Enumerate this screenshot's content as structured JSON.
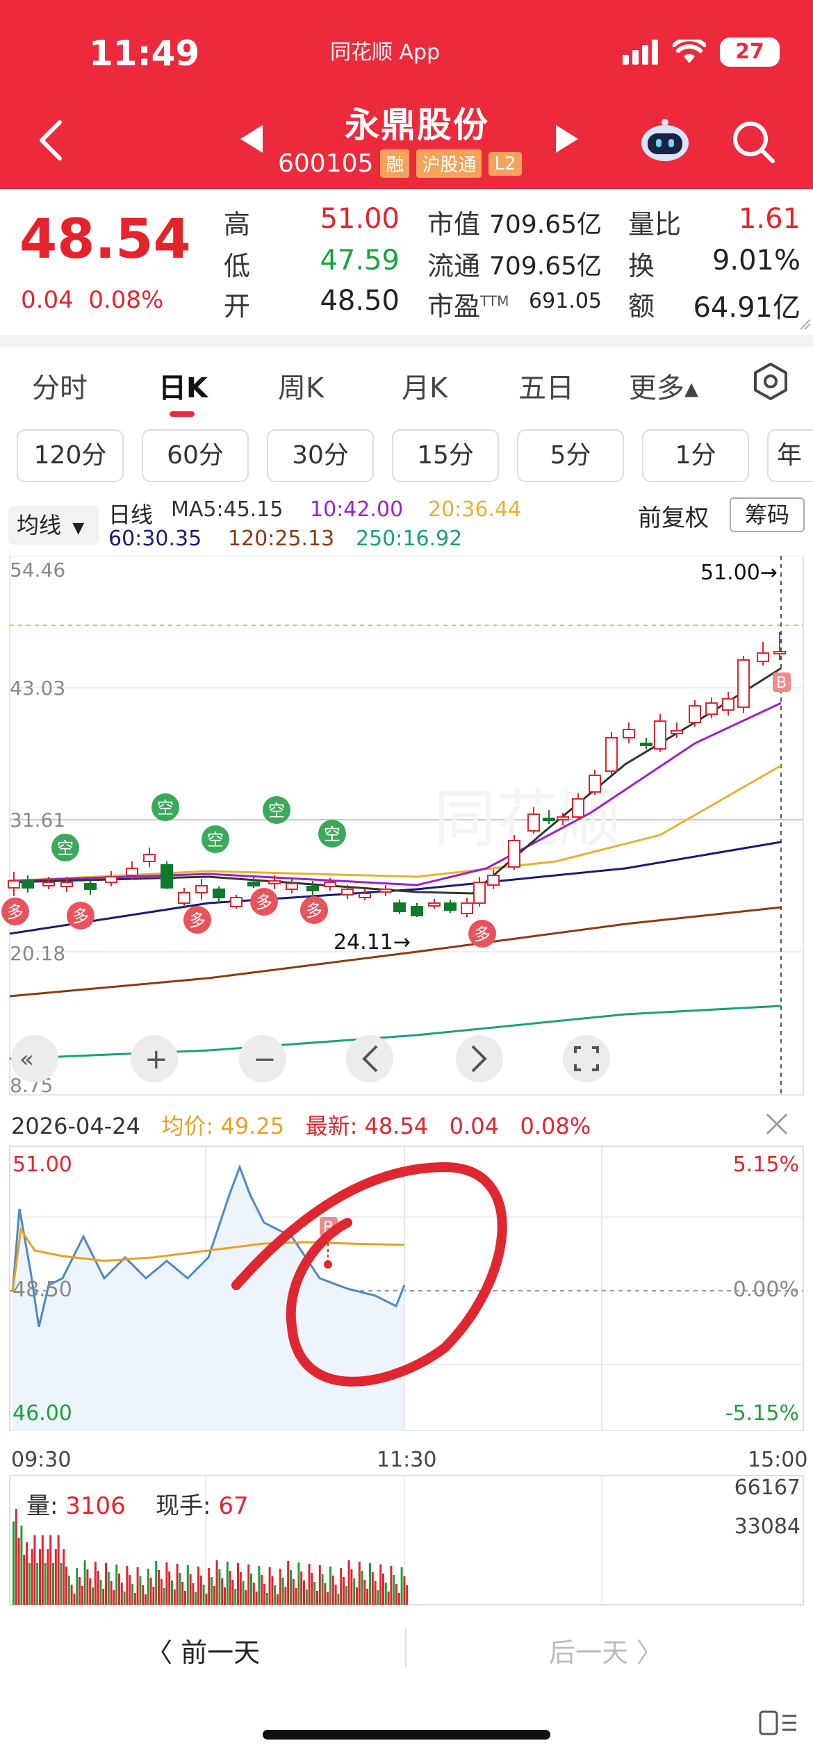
{
  "status": {
    "time": "11:49",
    "app_label": "同花顺 App",
    "battery": "27"
  },
  "header": {
    "stock_name": "永鼎股份",
    "stock_code": "600105",
    "tags": [
      "融",
      "沪股通",
      "L2"
    ]
  },
  "quote": {
    "price": "48.54",
    "change": "0.04",
    "change_pct": "0.08%",
    "high_label": "高",
    "high": "51.00",
    "low_label": "低",
    "low": "47.59",
    "open_label": "开",
    "open": "48.50",
    "mcap_label": "市值",
    "mcap": "709.65亿",
    "float_label": "流通",
    "float": "709.65亿",
    "pe_label": "市盈",
    "pe_sup": "TTM",
    "pe": "691.05",
    "vol_ratio_label": "量比",
    "vol_ratio": "1.61",
    "turnover_label": "换",
    "turnover": "9.01%",
    "amount_label": "额",
    "amount": "64.91亿"
  },
  "tabs": [
    "分时",
    "日K",
    "周K",
    "月K",
    "五日",
    "更多▴"
  ],
  "subtabs": [
    "120分",
    "60分",
    "30分",
    "15分",
    "5分",
    "1分",
    "年"
  ],
  "indicator": {
    "button": "均线",
    "kline_label": "日线",
    "ma5": "MA5:45.15",
    "ma10": "10:42.00",
    "ma20": "20:36.44",
    "ma60": "60:30.35",
    "ma120": "120:25.13",
    "ma250": "250:16.92",
    "fq": "前复权",
    "chip": "筹码"
  },
  "kchart": {
    "y_ticks": [
      "54.46",
      "43.03",
      "31.61",
      "20.18",
      "8.75"
    ],
    "max_label": "51.00→",
    "min_label": "24.11→",
    "signal_kong": "空",
    "signal_duo": "多",
    "signal_b": "B",
    "colors": {
      "up": "#e5232b",
      "down": "#0f7a2c",
      "ma5": "#333333",
      "ma10": "#9b1fd0",
      "ma20": "#e8b030",
      "ma60": "#1a1a7a",
      "ma120": "#8a3a12",
      "ma250": "#1aa07a"
    }
  },
  "intraday": {
    "date": "2026-04-24",
    "avg_label": "均价:",
    "avg": "49.25",
    "latest_label": "最新:",
    "latest": "48.54",
    "change": "0.04",
    "change_pct": "0.08%",
    "y_max": "51.00",
    "y_mid": "48.50",
    "y_min": "46.00",
    "pct_max": "5.15%",
    "pct_mid": "0.00%",
    "pct_min": "-5.15%",
    "t_start": "09:30",
    "t_mid": "11:30",
    "t_end": "15:00",
    "signal_b": "B"
  },
  "volume": {
    "vol_label": "量:",
    "vol": "3106",
    "hand_label": "现手:",
    "hand": "67",
    "tick_high": "66167",
    "tick_mid": "33084"
  },
  "nav": {
    "prev_day": "前一天",
    "next_day": "后一天"
  }
}
